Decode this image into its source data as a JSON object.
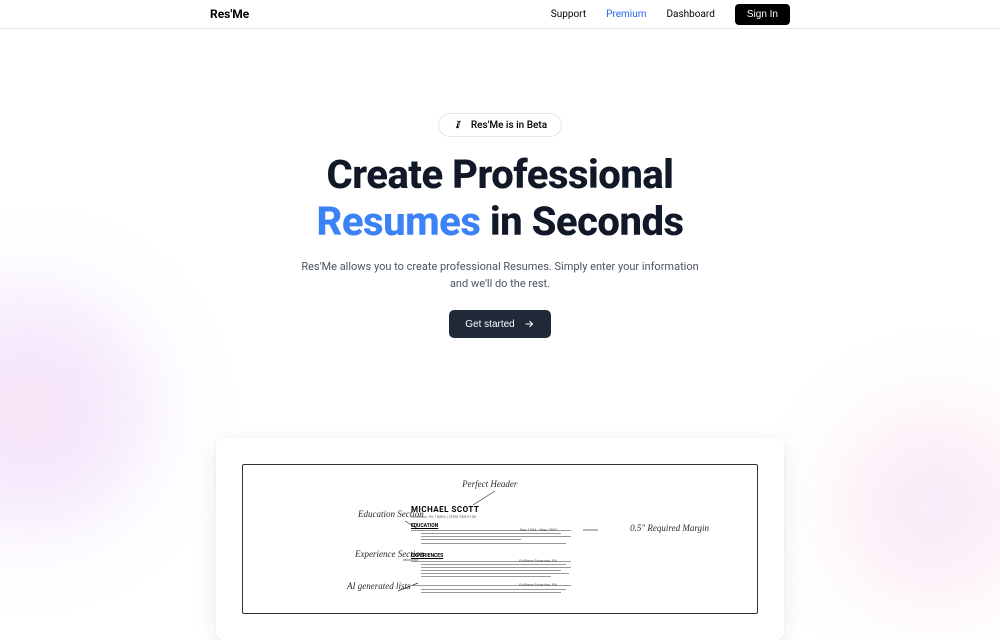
{
  "header": {
    "logo": "Res'Me",
    "nav": {
      "support": "Support",
      "premium": "Premium",
      "dashboard": "Dashboard",
      "signin": "Sign In"
    }
  },
  "hero": {
    "badge": "Res'Me is in Beta",
    "headline_line1": "Create Professional",
    "headline_accent": "Resumes",
    "headline_line2_rest": " in Seconds",
    "subtitle": "Res'Me allows you to create professional Resumes. Simply enter your information and we'll do the rest.",
    "cta": "Get started"
  },
  "preview": {
    "resume_name": "MICHAEL SCOTT",
    "annotations": {
      "header": "Perfect Header",
      "education": "Education Section",
      "experience": "Experience Section",
      "ai": "AI generated lists",
      "margin": "0.5\" Required Margin"
    },
    "sections": {
      "education": "EDUCATION",
      "experience": "EXPERIENCES"
    }
  }
}
